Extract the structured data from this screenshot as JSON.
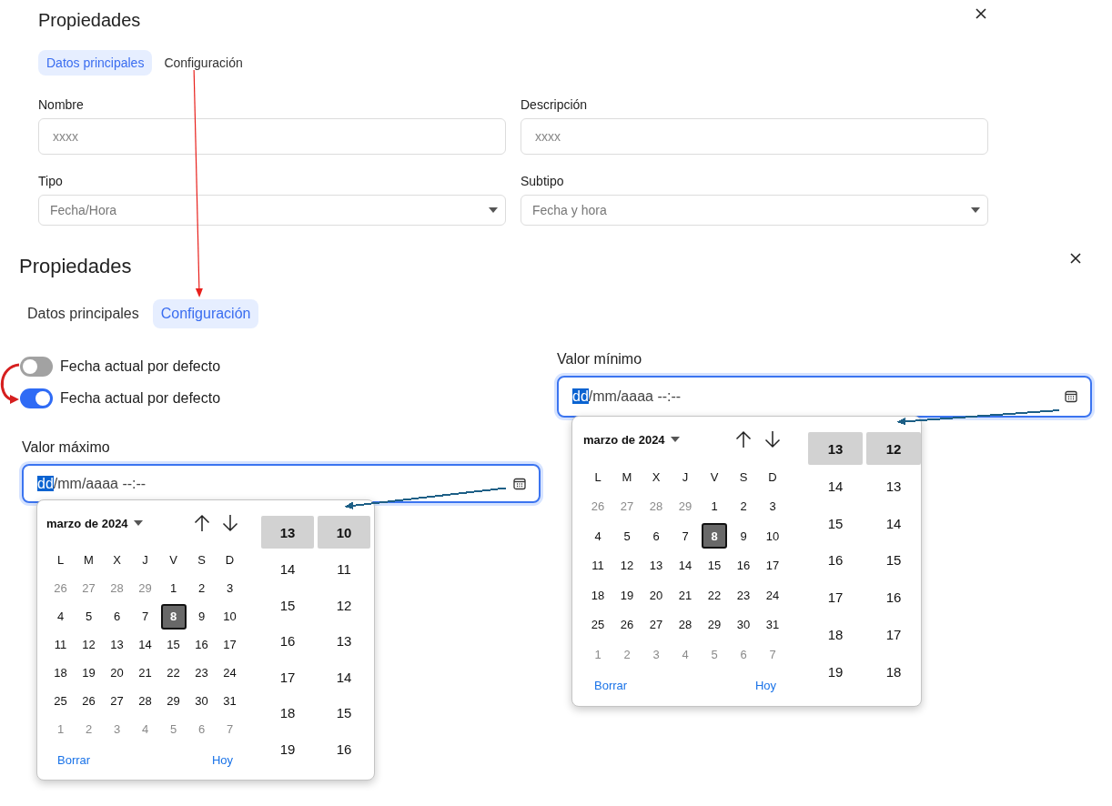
{
  "top_view": {
    "title": "Propiedades",
    "tabs": [
      {
        "label": "Datos principales",
        "selected": true
      },
      {
        "label": "Configuración",
        "selected": false
      }
    ],
    "fields": [
      {
        "kind": "text",
        "label": "Nombre",
        "placeholder": "xxxx"
      },
      {
        "kind": "text",
        "label": "Descripción",
        "placeholder": "xxxx"
      },
      {
        "kind": "select",
        "label": "Tipo",
        "value": "Fecha/Hora"
      },
      {
        "kind": "select",
        "label": "Subtipo",
        "value": "Fecha y hora"
      }
    ]
  },
  "bottom_view": {
    "title": "Propiedades",
    "tabs": [
      {
        "label": "Datos principales",
        "selected": false
      },
      {
        "label": "Configuración",
        "selected": true
      }
    ],
    "toggles": [
      {
        "label": "Fecha actual por defecto",
        "on": false
      },
      {
        "label": "Fecha actual por defecto",
        "on": true
      }
    ],
    "date_fields": [
      {
        "label": "Valor máximo",
        "focused": true,
        "segments": [
          {
            "text": "dd",
            "selected": true
          },
          {
            "text": "/mm/aaaa --:--",
            "selected": false
          }
        ],
        "picker": {
          "month": "marzo de 2024",
          "weekdays": [
            "L",
            "M",
            "X",
            "J",
            "V",
            "S",
            "D"
          ],
          "weeks": [
            [
              {
                "label": "26",
                "muted": true,
                "selected": false
              },
              {
                "label": "27",
                "muted": true,
                "selected": false
              },
              {
                "label": "28",
                "muted": true,
                "selected": false
              },
              {
                "label": "29",
                "muted": true,
                "selected": false
              },
              {
                "label": "1",
                "muted": false,
                "selected": false
              },
              {
                "label": "2",
                "muted": false,
                "selected": false
              },
              {
                "label": "3",
                "muted": false,
                "selected": false
              }
            ],
            [
              {
                "label": "4",
                "muted": false,
                "selected": false
              },
              {
                "label": "5",
                "muted": false,
                "selected": false
              },
              {
                "label": "6",
                "muted": false,
                "selected": false
              },
              {
                "label": "7",
                "muted": false,
                "selected": false
              },
              {
                "label": "8",
                "muted": false,
                "selected": true
              },
              {
                "label": "9",
                "muted": false,
                "selected": false
              },
              {
                "label": "10",
                "muted": false,
                "selected": false
              }
            ],
            [
              {
                "label": "11",
                "muted": false,
                "selected": false
              },
              {
                "label": "12",
                "muted": false,
                "selected": false
              },
              {
                "label": "13",
                "muted": false,
                "selected": false
              },
              {
                "label": "14",
                "muted": false,
                "selected": false
              },
              {
                "label": "15",
                "muted": false,
                "selected": false
              },
              {
                "label": "16",
                "muted": false,
                "selected": false
              },
              {
                "label": "17",
                "muted": false,
                "selected": false
              }
            ],
            [
              {
                "label": "18",
                "muted": false,
                "selected": false
              },
              {
                "label": "19",
                "muted": false,
                "selected": false
              },
              {
                "label": "20",
                "muted": false,
                "selected": false
              },
              {
                "label": "21",
                "muted": false,
                "selected": false
              },
              {
                "label": "22",
                "muted": false,
                "selected": false
              },
              {
                "label": "23",
                "muted": false,
                "selected": false
              },
              {
                "label": "24",
                "muted": false,
                "selected": false
              }
            ],
            [
              {
                "label": "25",
                "muted": false,
                "selected": false
              },
              {
                "label": "26",
                "muted": false,
                "selected": false
              },
              {
                "label": "27",
                "muted": false,
                "selected": false
              },
              {
                "label": "28",
                "muted": false,
                "selected": false
              },
              {
                "label": "29",
                "muted": false,
                "selected": false
              },
              {
                "label": "30",
                "muted": false,
                "selected": false
              },
              {
                "label": "31",
                "muted": false,
                "selected": false
              }
            ],
            [
              {
                "label": "1",
                "muted": true,
                "selected": false
              },
              {
                "label": "2",
                "muted": true,
                "selected": false
              },
              {
                "label": "3",
                "muted": true,
                "selected": false
              },
              {
                "label": "4",
                "muted": true,
                "selected": false
              },
              {
                "label": "5",
                "muted": true,
                "selected": false
              },
              {
                "label": "6",
                "muted": true,
                "selected": false
              },
              {
                "label": "7",
                "muted": true,
                "selected": false
              }
            ]
          ],
          "hours": [
            {
              "label": "13",
              "selected": true
            },
            {
              "label": "14",
              "selected": false
            },
            {
              "label": "15",
              "selected": false
            },
            {
              "label": "16",
              "selected": false
            },
            {
              "label": "17",
              "selected": false
            },
            {
              "label": "18",
              "selected": false
            },
            {
              "label": "19",
              "selected": false
            }
          ],
          "minutes": [
            {
              "label": "10",
              "selected": true
            },
            {
              "label": "11",
              "selected": false
            },
            {
              "label": "12",
              "selected": false
            },
            {
              "label": "13",
              "selected": false
            },
            {
              "label": "14",
              "selected": false
            },
            {
              "label": "15",
              "selected": false
            },
            {
              "label": "16",
              "selected": false
            }
          ],
          "actions": [
            "Borrar",
            "Hoy"
          ]
        }
      },
      {
        "label": "Valor mínimo",
        "focused": true,
        "segments": [
          {
            "text": "dd",
            "selected": true
          },
          {
            "text": "/mm/aaaa --:--",
            "selected": false
          }
        ],
        "picker": {
          "month": "marzo de 2024",
          "weekdays": [
            "L",
            "M",
            "X",
            "J",
            "V",
            "S",
            "D"
          ],
          "weeks": [
            [
              {
                "label": "26",
                "muted": true,
                "selected": false
              },
              {
                "label": "27",
                "muted": true,
                "selected": false
              },
              {
                "label": "28",
                "muted": true,
                "selected": false
              },
              {
                "label": "29",
                "muted": true,
                "selected": false
              },
              {
                "label": "1",
                "muted": false,
                "selected": false
              },
              {
                "label": "2",
                "muted": false,
                "selected": false
              },
              {
                "label": "3",
                "muted": false,
                "selected": false
              }
            ],
            [
              {
                "label": "4",
                "muted": false,
                "selected": false
              },
              {
                "label": "5",
                "muted": false,
                "selected": false
              },
              {
                "label": "6",
                "muted": false,
                "selected": false
              },
              {
                "label": "7",
                "muted": false,
                "selected": false
              },
              {
                "label": "8",
                "muted": false,
                "selected": true
              },
              {
                "label": "9",
                "muted": false,
                "selected": false
              },
              {
                "label": "10",
                "muted": false,
                "selected": false
              }
            ],
            [
              {
                "label": "11",
                "muted": false,
                "selected": false
              },
              {
                "label": "12",
                "muted": false,
                "selected": false
              },
              {
                "label": "13",
                "muted": false,
                "selected": false
              },
              {
                "label": "14",
                "muted": false,
                "selected": false
              },
              {
                "label": "15",
                "muted": false,
                "selected": false
              },
              {
                "label": "16",
                "muted": false,
                "selected": false
              },
              {
                "label": "17",
                "muted": false,
                "selected": false
              }
            ],
            [
              {
                "label": "18",
                "muted": false,
                "selected": false
              },
              {
                "label": "19",
                "muted": false,
                "selected": false
              },
              {
                "label": "20",
                "muted": false,
                "selected": false
              },
              {
                "label": "21",
                "muted": false,
                "selected": false
              },
              {
                "label": "22",
                "muted": false,
                "selected": false
              },
              {
                "label": "23",
                "muted": false,
                "selected": false
              },
              {
                "label": "24",
                "muted": false,
                "selected": false
              }
            ],
            [
              {
                "label": "25",
                "muted": false,
                "selected": false
              },
              {
                "label": "26",
                "muted": false,
                "selected": false
              },
              {
                "label": "27",
                "muted": false,
                "selected": false
              },
              {
                "label": "28",
                "muted": false,
                "selected": false
              },
              {
                "label": "29",
                "muted": false,
                "selected": false
              },
              {
                "label": "30",
                "muted": false,
                "selected": false
              },
              {
                "label": "31",
                "muted": false,
                "selected": false
              }
            ],
            [
              {
                "label": "1",
                "muted": true,
                "selected": false
              },
              {
                "label": "2",
                "muted": true,
                "selected": false
              },
              {
                "label": "3",
                "muted": true,
                "selected": false
              },
              {
                "label": "4",
                "muted": true,
                "selected": false
              },
              {
                "label": "5",
                "muted": true,
                "selected": false
              },
              {
                "label": "6",
                "muted": true,
                "selected": false
              },
              {
                "label": "7",
                "muted": true,
                "selected": false
              }
            ]
          ],
          "hours": [
            {
              "label": "13",
              "selected": true
            },
            {
              "label": "14",
              "selected": false
            },
            {
              "label": "15",
              "selected": false
            },
            {
              "label": "16",
              "selected": false
            },
            {
              "label": "17",
              "selected": false
            },
            {
              "label": "18",
              "selected": false
            },
            {
              "label": "19",
              "selected": false
            }
          ],
          "minutes": [
            {
              "label": "12",
              "selected": true
            },
            {
              "label": "13",
              "selected": false
            },
            {
              "label": "14",
              "selected": false
            },
            {
              "label": "15",
              "selected": false
            },
            {
              "label": "16",
              "selected": false
            },
            {
              "label": "17",
              "selected": false
            },
            {
              "label": "18",
              "selected": false
            }
          ],
          "actions": [
            "Borrar",
            "Hoy"
          ]
        }
      }
    ]
  },
  "annotation_arrows": [
    {
      "color": "#e8201c"
    },
    {
      "color": "#d61f1f"
    },
    {
      "color": "#1d5f86"
    },
    {
      "color": "#1d5f86"
    }
  ]
}
